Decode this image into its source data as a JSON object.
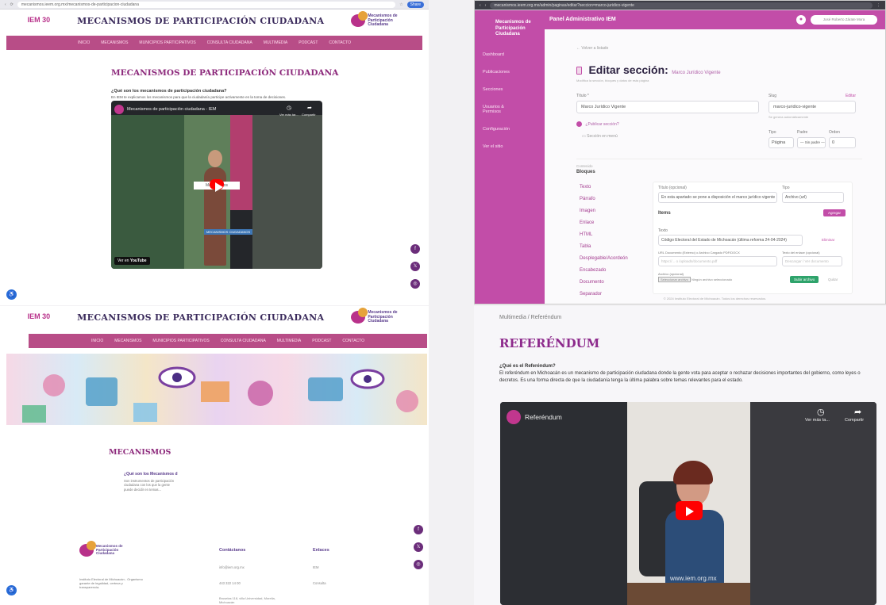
{
  "q1": {
    "browser": {
      "url": "mecanismos.ieem.org.mx/mecanismos-de-participacion-ciudadana",
      "share": "Share"
    },
    "brand": {
      "logo_left": "IEM 30",
      "site_title": "MECANISMOS DE PARTICIPACIÓN CIUDADANA",
      "logo_right": "Mecanismos de Participación Ciudadana"
    },
    "nav": [
      "INICIO",
      "MECANISMOS",
      "MUNICIPIOS PARTICIPATIVOS",
      "CONSULTA CIUDADANA",
      "MULTIMEDIA",
      "PODCAST",
      "CONTACTO"
    ],
    "page_title": "MECANISMOS DE PARTICIPACIÓN CIUDADANA",
    "question": "¿Qué son los mecanismos de participación ciudadana?",
    "paragraph": "En IEM te explicamos los mecanismos para que la ciudadanía participe activamente en la toma de decisiones.",
    "video": {
      "title": "Mecanismos de participación ciudadana - IEM",
      "watch_later": "Ver más tar...",
      "share": "Compartir",
      "watch_on": "Ver en",
      "youtube": "YouTube",
      "caption": "MECANISMOS CIUDADANOS",
      "banner": "Mecanismos"
    }
  },
  "q2": {
    "browser": {
      "url": "mecanismos.ieem.org.mx/admin/paginas/editar?seccion=marco-juridico-vigente"
    },
    "topbar": {
      "title": "Panel Administrativo IEM",
      "user": "José Roberto Zárate Mora"
    },
    "sidebar": {
      "brand": "Mecanismos de Participación Ciudadana",
      "items": [
        "Dashboard",
        "Publicaciones",
        "Secciones",
        "Usuarios & Permisos",
        "Configuración",
        "Ver el sitio"
      ]
    },
    "breadcrumb": "← Volver a listado",
    "heading": "Editar sección:",
    "heading_sub": "Marco Jurídico Vigente",
    "heading_note": "Modifica la sección, bloques y datos de esta página",
    "fields": {
      "title_label": "Título *",
      "title_value": "Marco Jurídico Vigente",
      "slug_label": "Slug",
      "slug_value": "marco-juridico-vigente",
      "slug_hint": "Se genera automáticamente",
      "slug_action": "Editar",
      "published": "¿Publicar sección?",
      "dropdown": "Sección en menú",
      "type_label": "Tipo",
      "type_value": "Página",
      "parent_label": "Padre",
      "parent_value": "— Sin padre —",
      "order_label": "Orden",
      "order_value": "0"
    },
    "blocks": {
      "section_label": "Contenido",
      "heading": "Bloques",
      "items": [
        "Texto",
        "Párrafo",
        "Imagen",
        "Enlace",
        "HTML",
        "Tabla",
        "Desplegable/Acordeón",
        "Encabezado",
        "Documento",
        "Separador"
      ],
      "title_label": "Título (opcional)",
      "title_value": "En esta apartado se pone a disposición el marco jurídico vigente",
      "type_label": "Tipo",
      "type_value": "Archivo (url)",
      "subheading": "Items",
      "add_button": "Agregar",
      "text_label": "Texto",
      "text_value": "Código Electoral del Estado de Michoacán (última reforma 24-04-2024)",
      "remove": "Eliminar",
      "url_label": "URL Documento (Externo) o Archivo Cargado PDF/DOCX",
      "url_placeholder": "https://... o /uploads/documento.pdf",
      "ext_label": "Texto del enlace (opcional)",
      "ext_placeholder": "Descargar / Ver documento",
      "file_label": "Archivo (opcional)",
      "file_button": "Seleccionar archivo",
      "file_status": "Ningún archivo seleccionado",
      "upload_button": "Subir archivo",
      "cancel": "Quitar"
    },
    "footer": "© 2024 Instituto Electoral de Michoacán. Todos los derechos reservados."
  },
  "q3": {
    "brand": {
      "logo_left": "IEM 30",
      "site_title": "MECANISMOS DE PARTICIPACIÓN CIUDADANA",
      "logo_right": "Mecanismos de Participación Ciudadana"
    },
    "nav": [
      "INICIO",
      "MECANISMOS",
      "MUNICIPIOS PARTICIPATIVOS",
      "CONSULTA CIUDADANA",
      "MULTIMEDIA",
      "PODCAST",
      "CONTACTO"
    ],
    "section_title": "MECANISMOS",
    "card": {
      "title": "¿Qué son los Mecanismos d",
      "text": "Son instrumentos de participación ciudadana con los que la gente puede decidir en temas..."
    },
    "footer": {
      "brand": "Mecanismos de Participación Ciudadana",
      "about": "Instituto Electoral de Michoacán - Organismo garante de legalidad, certeza y transparencia.",
      "contact_title": "Contáctanos",
      "contact": [
        "info@iem.org.mx",
        "443 322 14 00",
        "Bruselas 118, villa Universidad, Morelia, Michoacán"
      ],
      "links_title": "Enlaces",
      "links": [
        "IEM",
        "Consulta"
      ]
    }
  },
  "q4": {
    "breadcrumb": "Multimedia / Referéndum",
    "title": "REFERÉNDUM",
    "question": "¿Qué es el Referéndum?",
    "paragraph": "El referéndum en Michoacán es un mecanismo de participación ciudadana donde la gente vota para aceptar o rechazar decisiones importantes del gobierno, como leyes o decretos. Es una forma directa de que la ciudadanía tenga la última palabra sobre temas relevantes para el estado.",
    "video": {
      "title": "Referéndum",
      "watch_later": "Ver más ta...",
      "share": "Compartir",
      "watermark": "www.iem.org.mx"
    }
  },
  "colors": {
    "brand_pink": "#b84d87",
    "admin_pink": "#c24da8",
    "title_purple": "#8d2a7c",
    "youtube_red": "#ff0000"
  }
}
